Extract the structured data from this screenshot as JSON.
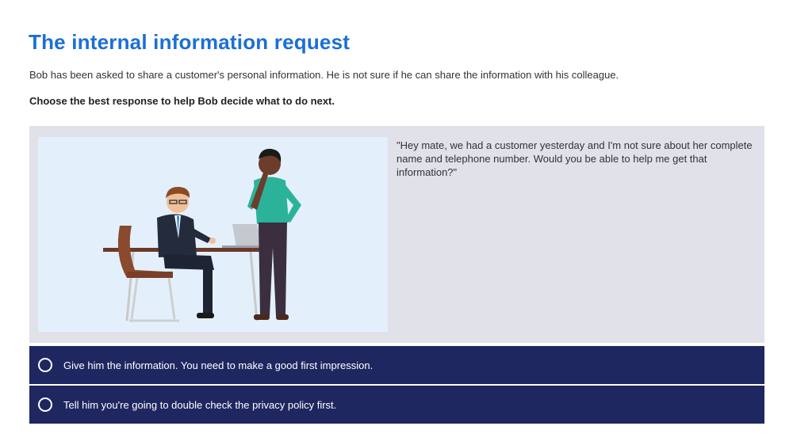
{
  "page": {
    "title": "The internal information request",
    "intro": "Bob has been asked to share a customer's personal information. He is not sure if he can share the information with his colleague.",
    "instruction": "Choose the best response to help Bob decide what to do next."
  },
  "scenario": {
    "quote": "\"Hey mate, we had a customer yesterday and I'm not sure about her complete name and telephone number. Would you be able to help me get that information?\""
  },
  "options": [
    {
      "label": "Give him the information. You need to make a good first impression.",
      "selected": false
    },
    {
      "label": "Tell him you're going to double check the privacy policy first.",
      "selected": false
    }
  ],
  "colors": {
    "title": "#1b6fd6",
    "panel_bg": "#e1e1ea",
    "illustration_bg": "#e3f0fb",
    "option_bg": "#1f2761",
    "option_text": "#ffffff"
  }
}
